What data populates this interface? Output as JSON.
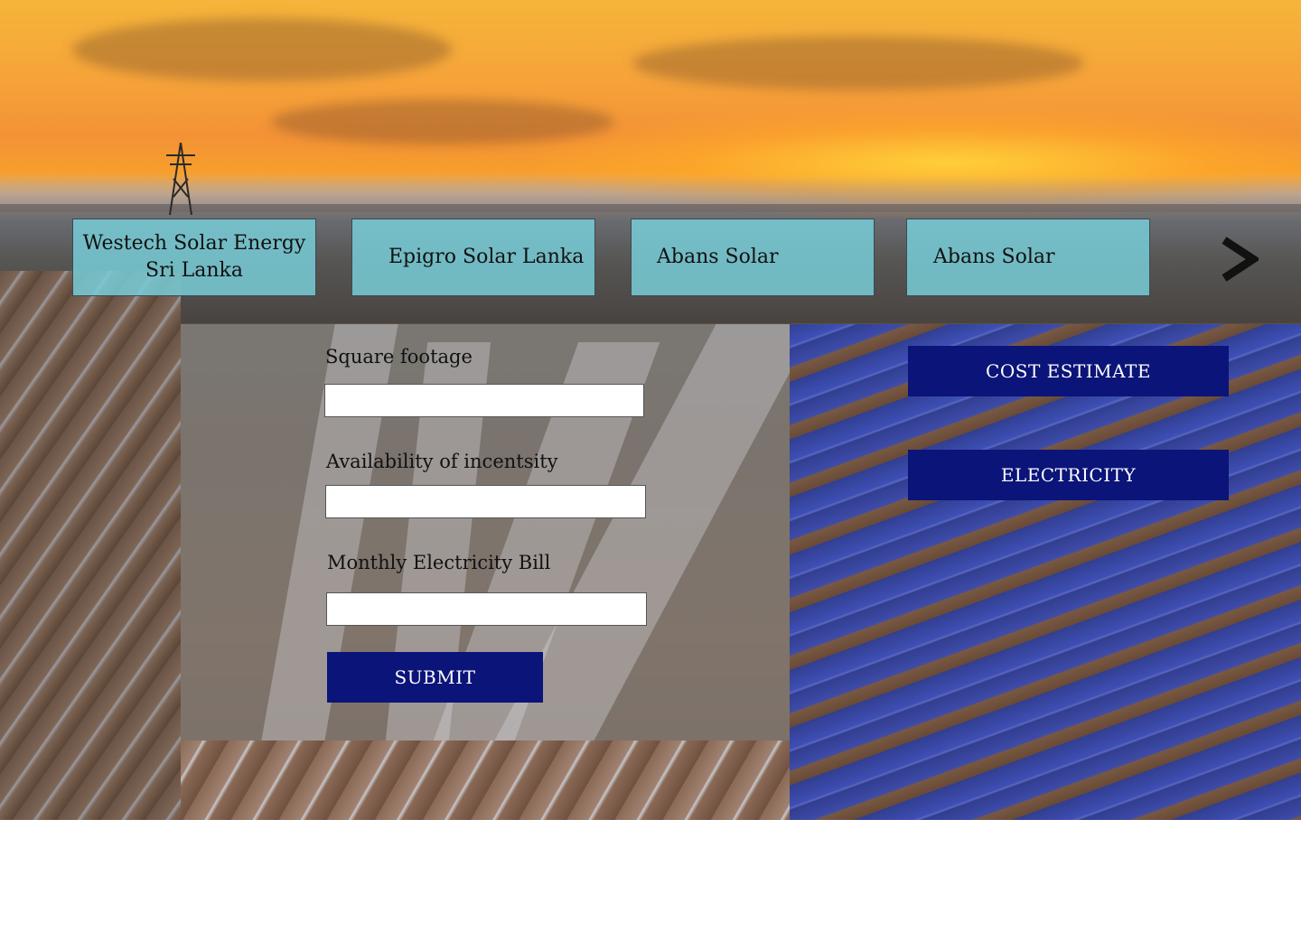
{
  "providers": [
    {
      "label_line1": "Westech Solar Energy",
      "label_line2": "Sri Lanka"
    },
    {
      "label_line1": "Epigro Solar Lanka",
      "label_line2": ""
    },
    {
      "label_line1": "Abans Solar",
      "label_line2": ""
    },
    {
      "label_line1": "Abans Solar",
      "label_line2": ""
    }
  ],
  "carousel": {
    "next_icon": "chevron-right-icon"
  },
  "form": {
    "square_footage_label": "Square  footage",
    "square_footage_value": "",
    "incentives_label": "Availability of incentsity",
    "incentives_value": "",
    "bill_label": "Monthly Electricity Bill",
    "bill_value": "",
    "submit_label": "SUBMIT"
  },
  "actions": {
    "cost_estimate_label": "COST ESTIMATE",
    "electricity_label": "ELECTRICITY"
  },
  "colors": {
    "button_bg": "#0b1478",
    "tile_bg": "#78cdd7",
    "panel_bg": "#969696"
  }
}
